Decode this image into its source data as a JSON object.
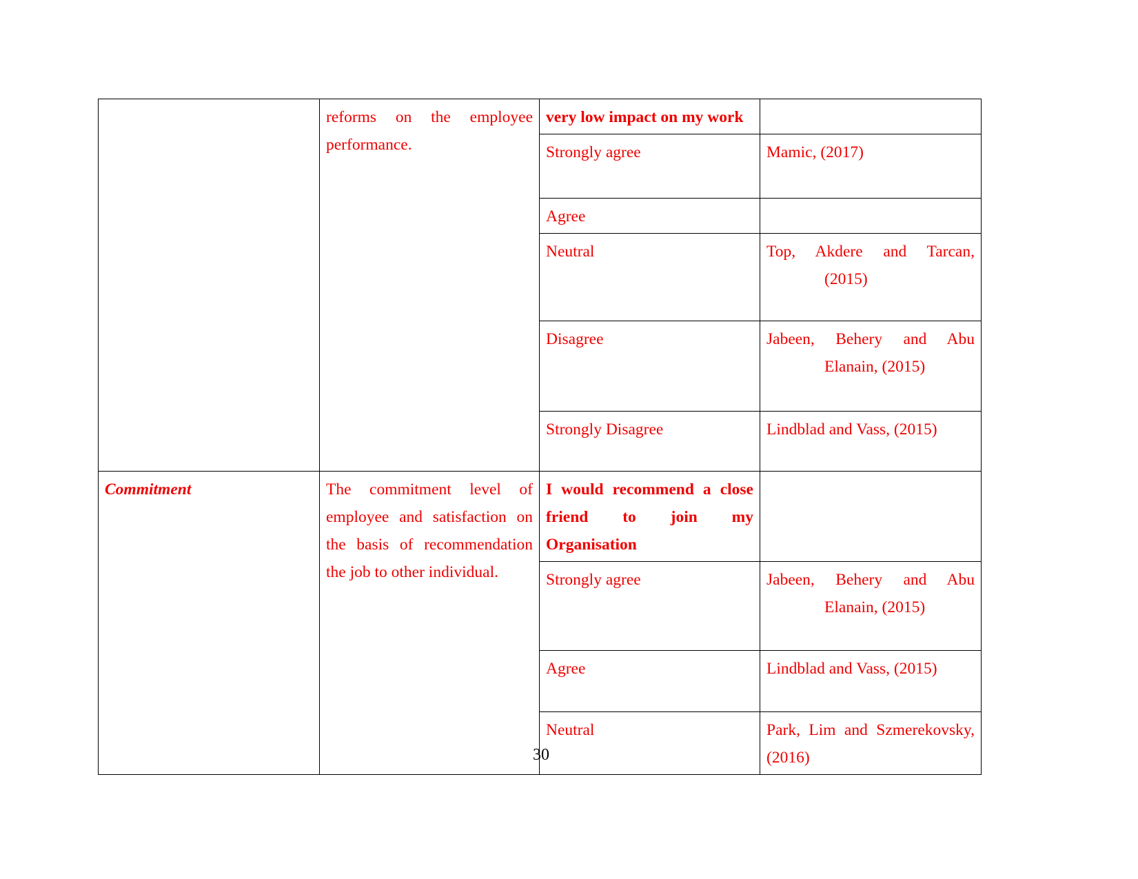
{
  "document": {
    "page_number": "30",
    "text_color": "#ee0000",
    "page_number_color": "#000000"
  },
  "table": {
    "rows": [
      {
        "construct": "",
        "definition_lines": [
          "reforms",
          "on",
          "the",
          "employee",
          "performance."
        ],
        "definition_line1": "reforms on the employee",
        "definition_line2": "performance.",
        "scale_items": [
          {
            "label_line1": "very low impact on my work",
            "label": "very low impact on my work",
            "bold": true,
            "source_line1": "",
            "source_line2": "",
            "source": ""
          },
          {
            "label": "Strongly agree",
            "bold": false,
            "source_line1": "Mamic, (2017)",
            "source_line2": "",
            "source": "Mamic, (2017)"
          },
          {
            "label": "Agree",
            "bold": false,
            "source_line1": "",
            "source_line2": "",
            "source": ""
          },
          {
            "label": "Neutral",
            "bold": false,
            "source_line1": "Top, Akdere and Tarcan,",
            "source_line2": "(2015)",
            "source": "Top, Akdere and Tarcan, (2015)"
          },
          {
            "label": "Disagree",
            "bold": false,
            "source_line1": "Jabeen, Behery and Abu",
            "source_line2": "Elanain, (2015)",
            "source": "Jabeen, Behery and Abu Elanain, (2015)"
          },
          {
            "label": "Strongly Disagree",
            "bold": false,
            "source_line1": "Lindblad and Vass, (2015)",
            "source_line2": "",
            "source": "Lindblad and Vass, (2015)"
          }
        ]
      },
      {
        "construct": "Commitment",
        "definition_line1": "The commitment level of",
        "definition_line2": "employee and satisfaction on",
        "definition_line3": "the basis of recommendation",
        "definition_line4": "the job to other individual.",
        "definition": "The commitment level of employee and satisfaction on the basis of recommendation the job to other individual.",
        "scale_items": [
          {
            "label_line1": "I would recommend a close",
            "label_line2": "friend to join my",
            "label_line3": "Organisation",
            "label": "I would recommend a close friend to join my Organisation",
            "bold": true,
            "source_line1": "",
            "source_line2": "",
            "source": ""
          },
          {
            "label": "Strongly agree",
            "bold": false,
            "source_line1": "Jabeen, Behery and Abu",
            "source_line2": "Elanain, (2015)",
            "source": "Jabeen, Behery and Abu Elanain, (2015)"
          },
          {
            "label": "Agree",
            "bold": false,
            "source_line1": "Lindblad and Vass, (2015)",
            "source_line2": "",
            "source": "Lindblad and Vass, (2015)"
          },
          {
            "label": "Neutral",
            "bold": false,
            "source_line1": "Park, Lim and Szmerekovsky,",
            "source_line2": "(2016)",
            "source": "Park, Lim and Szmerekovsky, (2016)"
          }
        ]
      }
    ]
  }
}
